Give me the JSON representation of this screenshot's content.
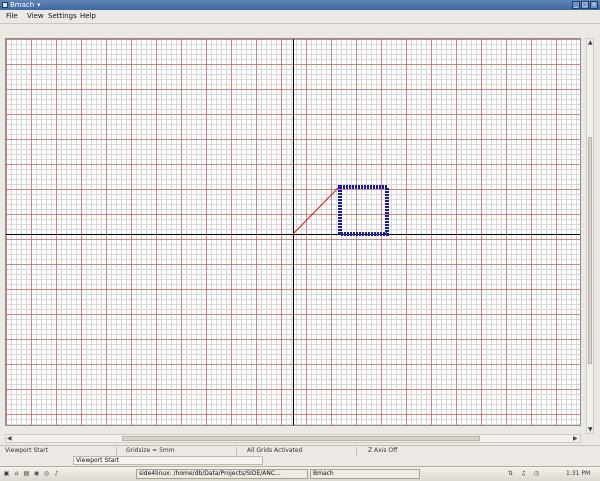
{
  "window": {
    "title": "Bmach",
    "title_arrow_icon": "dropdown-arrow-icon",
    "controls": {
      "minimize_icon": "minimize-icon",
      "maximize_icon": "maximize-icon",
      "close_icon": "close-icon"
    }
  },
  "menu": {
    "items": [
      "File",
      "View",
      "Settings",
      "Help"
    ]
  },
  "canvas": {
    "background": "#ffffff",
    "fine_grid_color": "#d7d7d7",
    "major_grid_color": "#c04646",
    "axis_color": "#000000",
    "shape_color": "#1a1aa8",
    "toolpath_color": "#d01818"
  },
  "scrollbars": {
    "vertical_up_icon": "scroll-up-icon",
    "vertical_down_icon": "scroll-down-icon",
    "horizontal_left_icon": "scroll-left-icon",
    "horizontal_right_icon": "scroll-right-icon"
  },
  "status": {
    "viewport": "Viewport Start",
    "gridsize": "Gridsize = 5mm",
    "grids": "All Grids Activated",
    "zaxis": "Z Axis Off"
  },
  "hint": {
    "text": "Viewport Start"
  },
  "taskbar": {
    "icons": [
      "terminal-icon",
      "home-folder-icon",
      "document-icon",
      "camera-icon",
      "browser-icon",
      "sound-icon"
    ],
    "tasks": [
      {
        "label": "side4linux: /home/db/Data/Projects/SIDE/ANC..."
      },
      {
        "label": "Bmach"
      }
    ],
    "tray_icons": [
      "network-icon",
      "volume-icon",
      "clock-icon"
    ],
    "clock": "1:31 PM"
  }
}
